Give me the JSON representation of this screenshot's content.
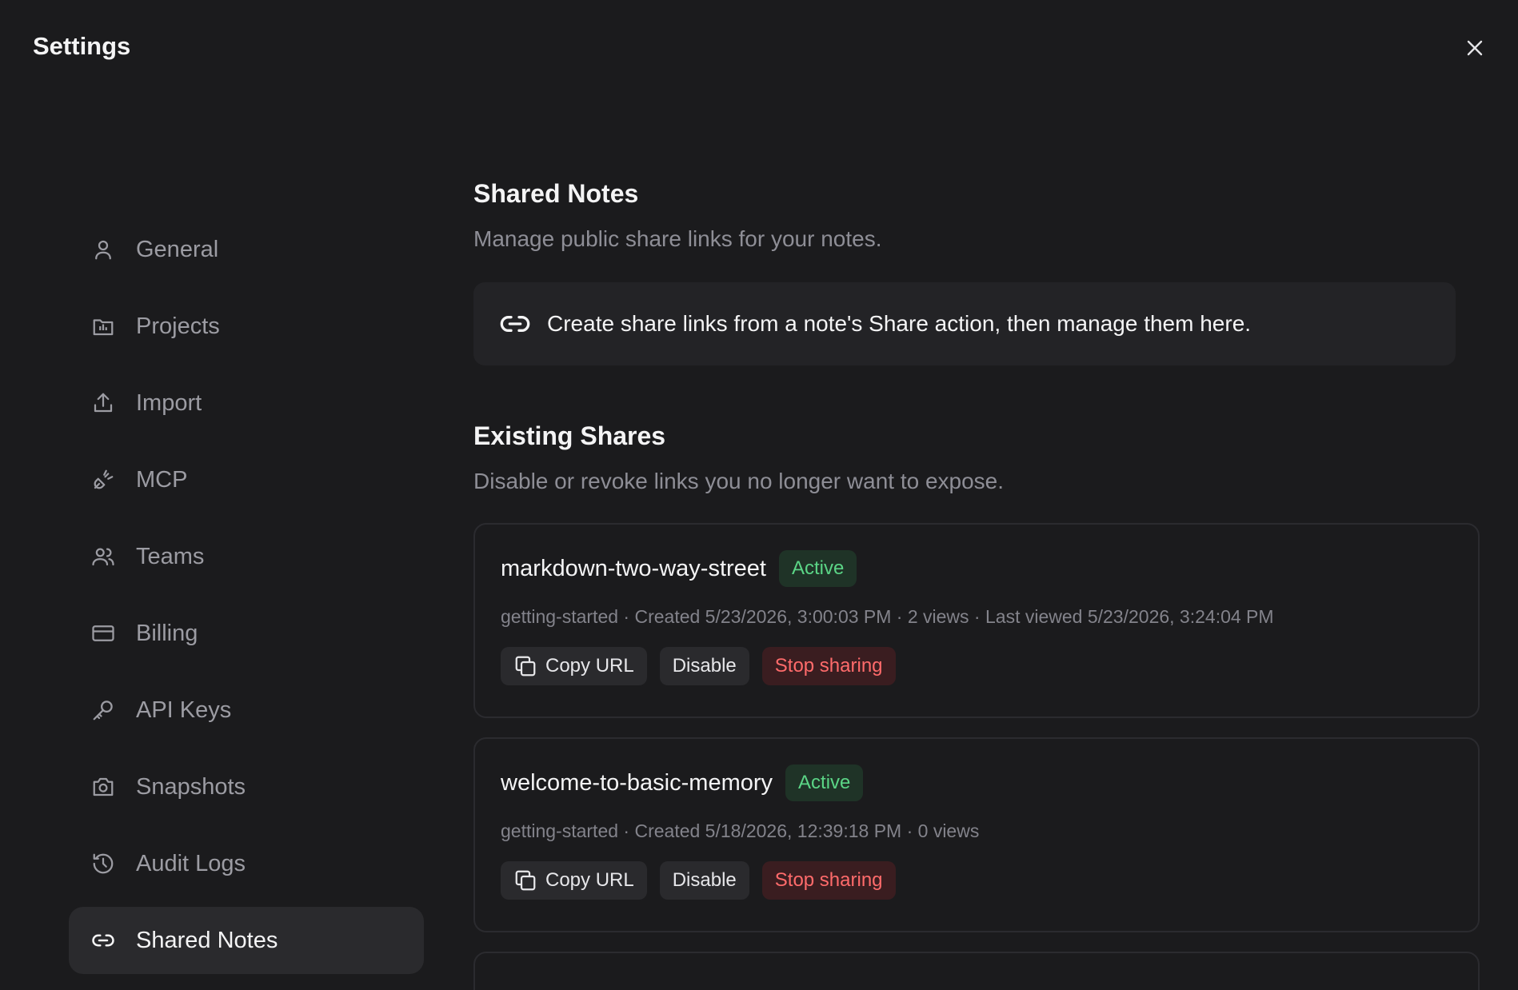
{
  "window": {
    "title": "Settings"
  },
  "sidebar": {
    "items": [
      {
        "label": "General",
        "icon": "user-icon"
      },
      {
        "label": "Projects",
        "icon": "folder-icon"
      },
      {
        "label": "Import",
        "icon": "upload-icon"
      },
      {
        "label": "MCP",
        "icon": "plug-icon"
      },
      {
        "label": "Teams",
        "icon": "users-icon"
      },
      {
        "label": "Billing",
        "icon": "credit-card-icon"
      },
      {
        "label": "API Keys",
        "icon": "key-icon"
      },
      {
        "label": "Snapshots",
        "icon": "camera-icon"
      },
      {
        "label": "Audit Logs",
        "icon": "history-icon"
      },
      {
        "label": "Shared Notes",
        "icon": "link-icon",
        "active": true
      }
    ]
  },
  "main": {
    "title": "Shared Notes",
    "subtitle": "Manage public share links for your notes.",
    "info": "Create share links from a note's Share action, then manage them here.",
    "existing_title": "Existing Shares",
    "existing_subtitle": "Disable or revoke links you no longer want to expose.",
    "shares": [
      {
        "name": "markdown-two-way-street",
        "status": "Active",
        "meta": "getting-started · Created 5/23/2026, 3:00:03 PM · 2 views · Last viewed 5/23/2026, 3:24:04 PM",
        "copy_label": "Copy URL",
        "disable_label": "Disable",
        "stop_label": "Stop sharing"
      },
      {
        "name": "welcome-to-basic-memory",
        "status": "Active",
        "meta": "getting-started · Created 5/18/2026, 12:39:18 PM · 0 views",
        "copy_label": "Copy URL",
        "disable_label": "Disable",
        "stop_label": "Stop sharing"
      }
    ]
  },
  "colors": {
    "background": "#1b1b1d",
    "active_badge_text": "#5bd586",
    "danger_text": "#ff6b6b"
  }
}
